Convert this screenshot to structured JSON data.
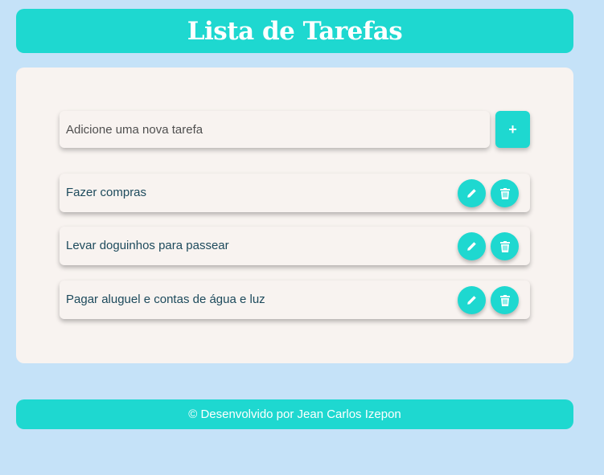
{
  "header": {
    "title": "Lista de Tarefas"
  },
  "add_task": {
    "placeholder": "Adicione uma nova tarefa",
    "button_label": "+"
  },
  "tasks": [
    {
      "text": "Fazer compras",
      "edit_icon": "pencil-icon",
      "delete_icon": "trash-icon"
    },
    {
      "text": "Levar doguinhos para passear",
      "edit_icon": "pencil-icon",
      "delete_icon": "trash-icon"
    },
    {
      "text": "Pagar aluguel e contas de água e luz",
      "edit_icon": "pencil-icon",
      "delete_icon": "trash-icon"
    }
  ],
  "footer": {
    "text": "© Desenvolvido por Jean Carlos Izepon"
  },
  "colors": {
    "accent": "#1ed8d0",
    "background": "#c5e2f8",
    "card": "#f8f3f0",
    "task_text": "#1d4a5c"
  }
}
